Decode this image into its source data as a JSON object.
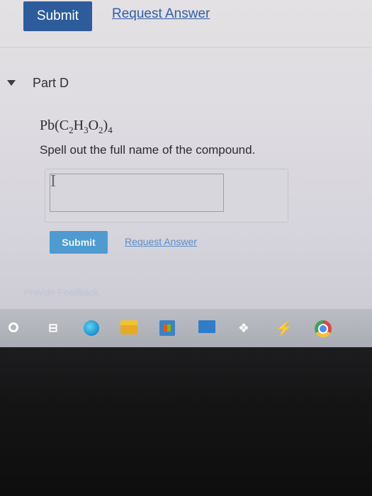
{
  "top_actions": {
    "submit_label": "Submit",
    "request_answer_label": "Request Answer"
  },
  "part": {
    "title": "Part D",
    "formula": {
      "prefix": "Pb(C",
      "sub1": "2",
      "h": "H",
      "sub2": "3",
      "o": "O",
      "sub3": "2",
      "close": ")",
      "sub4": "4"
    },
    "instruction": "Spell out the full name of the compound.",
    "answer_value": "",
    "cursor_glyph": "I",
    "submit_label": "Submit",
    "request_answer_label": "Request Answer"
  },
  "feedback_link": "Provide Feedback",
  "taskbar": {
    "task_view_glyph": "⊟",
    "dropbox_glyph": "❖",
    "bolt_glyph": "⚡"
  },
  "colors": {
    "submit_button": "#2d5b9b",
    "link": "#2f5fa7",
    "submit_button_active": "#4f9bd0"
  }
}
